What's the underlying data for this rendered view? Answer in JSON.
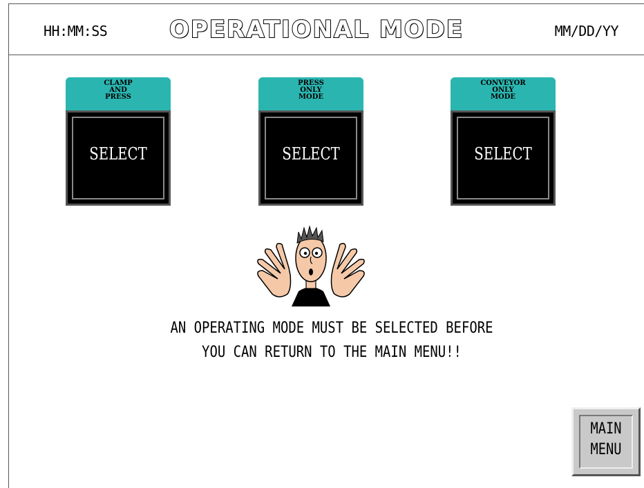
{
  "header": {
    "time": "HH:MM:SS",
    "title": "OPERATIONAL MODE",
    "date": "MM/DD/YY"
  },
  "modes": [
    {
      "label": "CLAMP\nAND\nPRESS",
      "button": "SELECT"
    },
    {
      "label": "PRESS\nONLY\nMODE",
      "button": "SELECT"
    },
    {
      "label": "CONVEYOR\nONLY\nMODE",
      "button": "SELECT"
    }
  ],
  "message": {
    "line1": "AN OPERATING MODE MUST BE SELECTED BEFORE",
    "line2": "YOU CAN RETURN TO THE MAIN MENU!!"
  },
  "main_menu": {
    "label": "MAIN\nMENU"
  },
  "colors": {
    "mode_label_bg": "#2bb5b0",
    "button_bg": "#000000"
  },
  "mascot": {
    "icon": "alarmed-man-icon"
  }
}
